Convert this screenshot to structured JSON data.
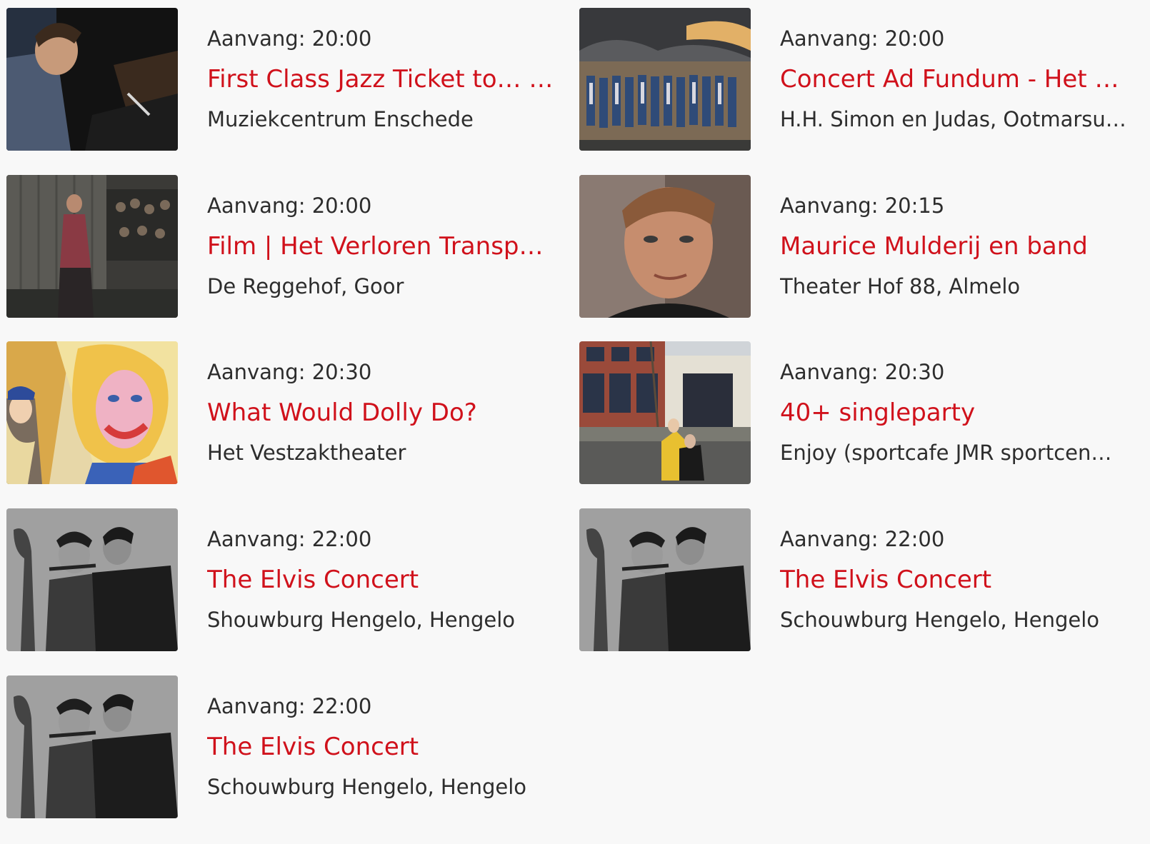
{
  "time_prefix": "Aanvang:",
  "events": [
    {
      "time": "Aanvang: 20:00",
      "title": "First Class Jazz Ticket to… …",
      "venue": "Muziekcentrum Enschede",
      "image": "jazz-pianist-photo"
    },
    {
      "time": "Aanvang: 20:00",
      "title": "Concert Ad Fundum - Het G…",
      "venue": "H.H. Simon en Judas, Ootmarsu…",
      "image": "choir-group-photo"
    },
    {
      "time": "Aanvang: 20:00",
      "title": "Film | Het Verloren Transpo…",
      "venue": "De Reggehof, Goor",
      "image": "film-still-photo"
    },
    {
      "time": "Aanvang: 20:15",
      "title": "Maurice Mulderij en band",
      "venue": "Theater Hof 88, Almelo",
      "image": "singer-portrait-photo"
    },
    {
      "time": "Aanvang: 20:30",
      "title": "What Would Dolly Do?",
      "venue": "Het Vestzaktheater",
      "image": "mural-photo"
    },
    {
      "time": "Aanvang: 20:30",
      "title": "40+ singleparty",
      "venue": "Enjoy (sportcafe JMR sportcen…",
      "image": "building-photo"
    },
    {
      "time": "Aanvang: 22:00",
      "title": "The Elvis Concert",
      "venue": "Shouwburg Hengelo, Hengelo",
      "image": "elvis-band-photo"
    },
    {
      "time": "Aanvang: 22:00",
      "title": "The Elvis Concert",
      "venue": "Schouwburg Hengelo, Hengelo",
      "image": "elvis-band-photo"
    },
    {
      "time": "Aanvang: 22:00",
      "title": "The Elvis Concert",
      "venue": "Schouwburg Hengelo, Hengelo",
      "image": "elvis-band-photo"
    }
  ],
  "colors": {
    "background": "#f8f8f8",
    "title": "#d0111b",
    "text": "#2d2d2d"
  }
}
